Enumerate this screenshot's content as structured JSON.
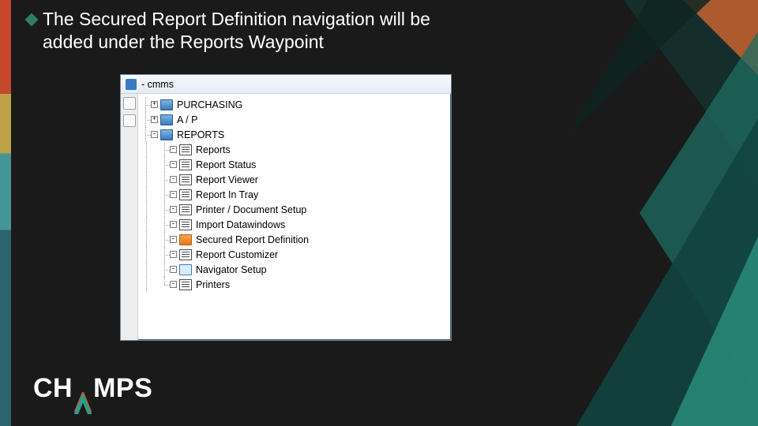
{
  "bullet": {
    "diamond_color": "#2e7d6b",
    "text": "The Secured Report Definition navigation will be added under the Reports Waypoint"
  },
  "logo": {
    "part1": "CH",
    "part3": "MPS"
  },
  "window": {
    "title": "- cmms",
    "tree": {
      "top": [
        {
          "label": "PURCHASING",
          "icon": "folder"
        },
        {
          "label": "A / P",
          "icon": "folder"
        }
      ],
      "reports_label": "REPORTS",
      "children": [
        {
          "label": "Reports",
          "icon": "report"
        },
        {
          "label": "Report Status",
          "icon": "report"
        },
        {
          "label": "Report Viewer",
          "icon": "report"
        },
        {
          "label": "Report In Tray",
          "icon": "report"
        },
        {
          "label": "Printer / Document Setup",
          "icon": "report"
        },
        {
          "label": "Import Datawindows",
          "icon": "report"
        },
        {
          "label": "Secured Report Definition",
          "icon": "orange"
        },
        {
          "label": "Report Customizer",
          "icon": "report"
        },
        {
          "label": "Navigator Setup",
          "icon": "monitor"
        },
        {
          "label": "Printers",
          "icon": "report"
        }
      ]
    }
  }
}
